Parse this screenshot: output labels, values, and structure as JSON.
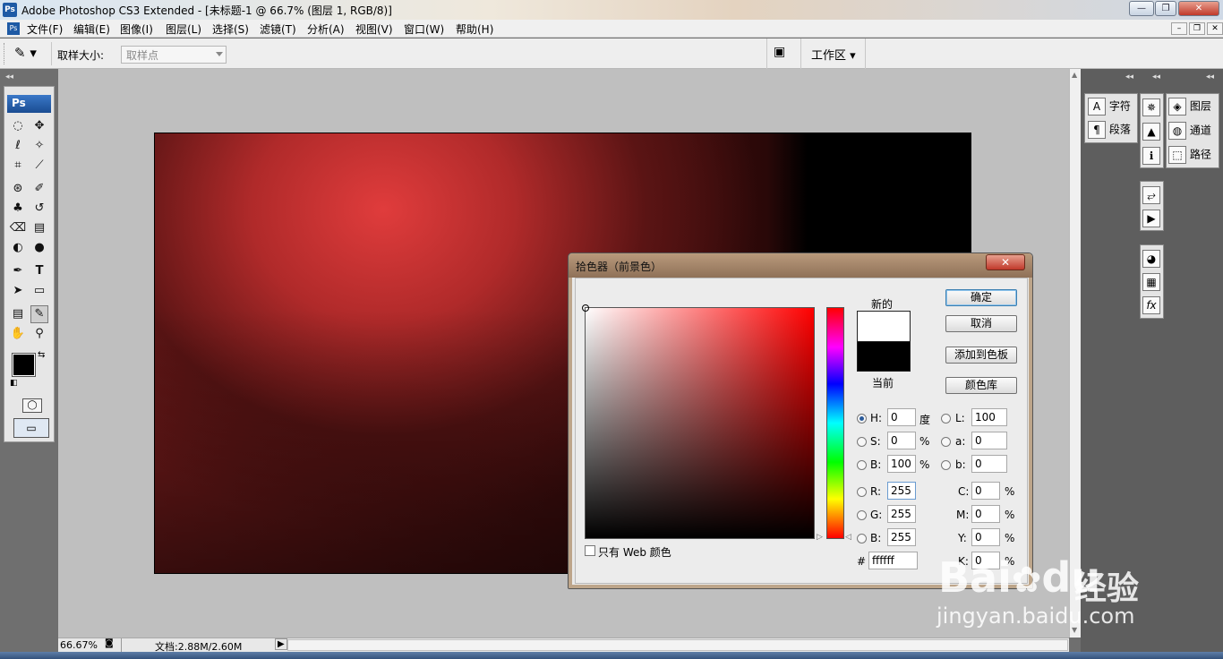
{
  "window": {
    "title": "Adobe Photoshop CS3 Extended - [未标题-1 @ 66.7% (图层 1, RGB/8)]",
    "logo": "Ps",
    "controls": [
      "minimize-icon",
      "maximize-icon",
      "close-icon"
    ]
  },
  "menubar": {
    "items": [
      "文件(F)",
      "编辑(E)",
      "图像(I)",
      "图层(L)",
      "选择(S)",
      "滤镜(T)",
      "分析(A)",
      "视图(V)",
      "窗口(W)",
      "帮助(H)"
    ]
  },
  "options": {
    "sample_size_label": "取样大小:",
    "sample_size_value": "取样点",
    "workspace_label": "工作区"
  },
  "toolbox": {
    "logo": "Ps"
  },
  "panels": {
    "char": "字符",
    "para": "段落",
    "layers": "图层",
    "channels": "通道",
    "paths": "路径"
  },
  "status": {
    "zoom": "66.67%",
    "doc": "文档:2.88M/2.60M"
  },
  "dialog": {
    "title": "拾色器（前景色）",
    "new_label": "新的",
    "current_label": "当前",
    "ok": "确定",
    "cancel": "取消",
    "add_swatches": "添加到色板",
    "color_libraries": "颜色库",
    "only_web": "只有 Web 颜色",
    "fields": {
      "H": {
        "label": "H:",
        "value": "0",
        "unit": "度"
      },
      "S": {
        "label": "S:",
        "value": "0",
        "unit": "%"
      },
      "B": {
        "label": "B:",
        "value": "100",
        "unit": "%"
      },
      "R": {
        "label": "R:",
        "value": "255"
      },
      "G": {
        "label": "G:",
        "value": "255"
      },
      "Bl": {
        "label": "B:",
        "value": "255"
      },
      "L": {
        "label": "L:",
        "value": "100"
      },
      "a": {
        "label": "a:",
        "value": "0"
      },
      "b": {
        "label": "b:",
        "value": "0"
      },
      "C": {
        "label": "C:",
        "value": "0",
        "unit": "%"
      },
      "M": {
        "label": "M:",
        "value": "0",
        "unit": "%"
      },
      "Y": {
        "label": "Y:",
        "value": "0",
        "unit": "%"
      },
      "K": {
        "label": "K:",
        "value": "0",
        "unit": "%"
      },
      "hex": {
        "label": "#",
        "value": "ffffff"
      }
    },
    "new_color": "#ffffff",
    "current_color": "#000000"
  },
  "colors": {
    "foreground": "#000000",
    "background": "#e03c3c"
  },
  "watermark": {
    "brand": "Bai",
    "brand2": "du",
    "cn": "经验",
    "url": "jingyan.baidu.com"
  }
}
